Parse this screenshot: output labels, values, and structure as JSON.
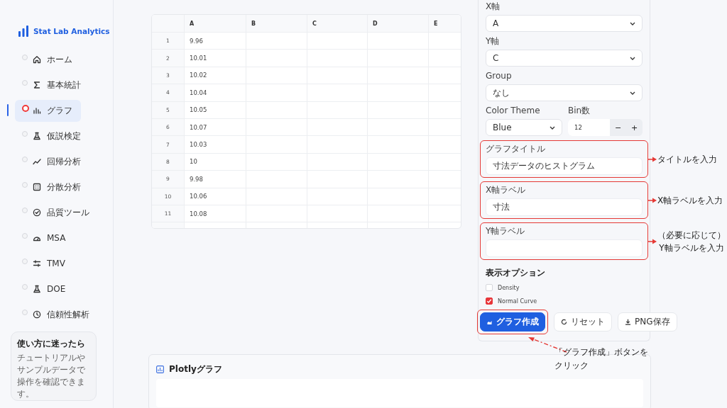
{
  "brand": {
    "name": "Stat Lab Analytics"
  },
  "nav": [
    {
      "label": "ホーム",
      "selected": false
    },
    {
      "label": "基本統計",
      "selected": false
    },
    {
      "label": "グラフ",
      "selected": true
    },
    {
      "label": "仮説検定",
      "selected": false
    },
    {
      "label": "回帰分析",
      "selected": false
    },
    {
      "label": "分散分析",
      "selected": false
    },
    {
      "label": "品質ツール",
      "selected": false
    },
    {
      "label": "MSA",
      "selected": false
    },
    {
      "label": "TMV",
      "selected": false
    },
    {
      "label": "DOE",
      "selected": false
    },
    {
      "label": "信頼性解析",
      "selected": false
    }
  ],
  "help": {
    "title": "使い方に迷ったら",
    "text": "チュートリアルやサンプルデータで操作を確認できます。"
  },
  "table": {
    "columns": [
      "A",
      "B",
      "C",
      "D",
      "E"
    ],
    "rows": [
      {
        "index": "1",
        "values": [
          "9.96"
        ]
      },
      {
        "index": "2",
        "values": [
          "10.01"
        ]
      },
      {
        "index": "3",
        "values": [
          "10.02"
        ]
      },
      {
        "index": "4",
        "values": [
          "10.04"
        ]
      },
      {
        "index": "5",
        "values": [
          "10.05"
        ]
      },
      {
        "index": "6",
        "values": [
          "10.07"
        ]
      },
      {
        "index": "7",
        "values": [
          "10.03"
        ]
      },
      {
        "index": "8",
        "values": [
          "10"
        ]
      },
      {
        "index": "9",
        "values": [
          "9.98"
        ]
      },
      {
        "index": "10",
        "values": [
          "10.06"
        ]
      },
      {
        "index": "11",
        "values": [
          "10.08"
        ]
      }
    ]
  },
  "settings": {
    "selects": [
      {
        "label": "X軸",
        "value": "A"
      },
      {
        "label": "Y軸",
        "value": "C"
      },
      {
        "label": "Group",
        "value": "なし"
      }
    ],
    "color_theme": {
      "label": "Color Theme",
      "value": "Blue"
    },
    "bins": {
      "label": "Bin数",
      "value": "12",
      "decrement": "−",
      "increment": "+"
    },
    "text_fields": [
      {
        "label": "グラフタイトル",
        "value": "寸法データのヒストグラム",
        "note": "タイトルを入力"
      },
      {
        "label": "X軸ラベル",
        "value": "寸法",
        "note": "X軸ラベルを入力"
      },
      {
        "label": "Y軸ラベル",
        "note": "（必要に応じて）\nY軸ラベルを入力"
      }
    ],
    "options_title": "表示オプション",
    "options": [
      {
        "label": "Density",
        "checked": false
      },
      {
        "label": "Normal Curve",
        "checked": true
      }
    ],
    "buttons": [
      {
        "label": "グラフ作成",
        "kind": "primary"
      },
      {
        "label": "リセット",
        "kind": "reset"
      },
      {
        "label": "PNG保存",
        "kind": "download"
      }
    ],
    "button_note": "「グラフ作成」ボタンをクリック"
  },
  "chart_card": {
    "title": "Plotlyグラフ"
  }
}
